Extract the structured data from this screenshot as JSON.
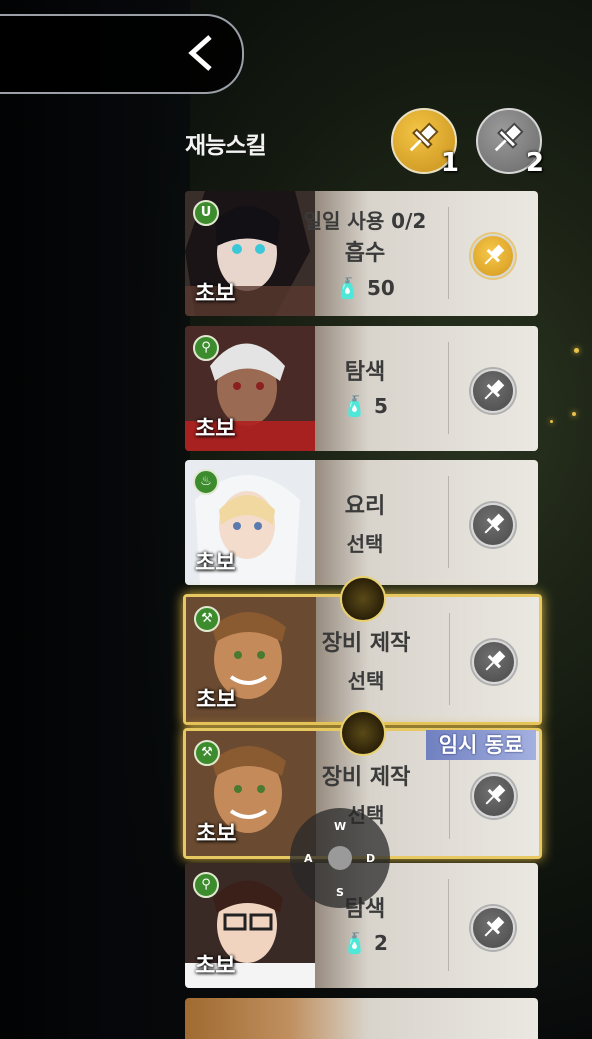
{
  "header": {
    "title": "재능스킬"
  },
  "slots": [
    {
      "number": "1",
      "color": "#e2ad2e",
      "icon": "pin-icon"
    },
    {
      "number": "2",
      "color": "#8a8a8a",
      "icon": "pin-icon"
    }
  ],
  "cards": [
    {
      "skill_icon": "magnet-icon",
      "level": "초보",
      "line1": "일일 사용 0/2",
      "line2": "흡수",
      "line3": "50",
      "pinned": true
    },
    {
      "skill_icon": "magnifier-icon",
      "level": "초보",
      "line1": "탐색",
      "line2": "5",
      "pinned": false
    },
    {
      "skill_icon": "chef-hat-icon",
      "level": "초보",
      "line1": "요리",
      "line2": "선택",
      "pinned": false
    },
    {
      "skill_icon": "hammer-icon",
      "level": "초보",
      "line1": "장비 제작",
      "line2": "선택",
      "pinned": false
    },
    {
      "skill_icon": "hammer-icon",
      "level": "초보",
      "line1": "장비 제작",
      "line2": "선택",
      "pinned": false,
      "badge": "임시 동료"
    },
    {
      "skill_icon": "magnifier-icon",
      "level": "초보",
      "line1": "탐색",
      "line2": "2",
      "pinned": false
    }
  ],
  "joystick": {
    "up": "W",
    "left": "A",
    "right": "D",
    "down": "S"
  }
}
